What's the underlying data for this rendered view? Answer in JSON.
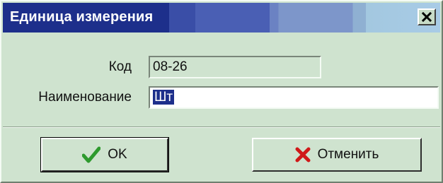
{
  "window": {
    "title": "Единица измерения",
    "close_glyph": "×"
  },
  "form": {
    "code": {
      "label": "Код",
      "value": "08-26"
    },
    "name": {
      "label": "Наименование",
      "value": "Шт"
    }
  },
  "buttons": {
    "ok": {
      "label": "OK",
      "icon": "checkmark-icon",
      "icon_color": "#2e9a2e"
    },
    "cancel": {
      "label": "Отменить",
      "icon": "x-mark-icon",
      "icon_color": "#d01818"
    }
  },
  "colors": {
    "titlebar_start": "#1d2f8b",
    "titlebar_end": "#a8cbe6",
    "dialog_background": "#cfe3cf"
  }
}
